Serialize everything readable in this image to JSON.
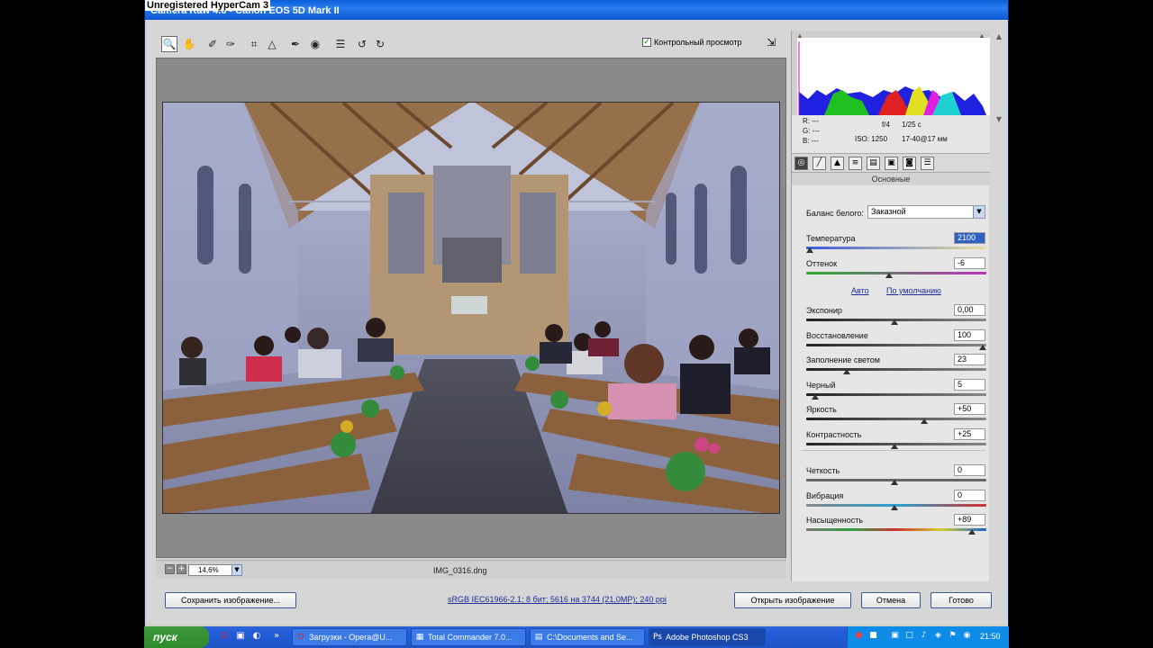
{
  "watermark": "Unregistered HyperCam 3",
  "window": {
    "title": "Camera Raw 4.6  -  Canon EOS 5D Mark II"
  },
  "toolbar": {
    "tools": [
      "zoom-icon",
      "hand-icon",
      "white-balance-icon",
      "color-sampler-icon",
      "crop-icon",
      "straighten-icon",
      "retouch-icon",
      "red-eye-icon",
      "preferences-icon",
      "rotate-left-icon",
      "rotate-right-icon"
    ],
    "preview_label": "Контрольный просмотр",
    "preview_checked": true
  },
  "status": {
    "zoom": "14,6%",
    "filename": "IMG_0316.dng"
  },
  "buttons": {
    "save": "Сохранить изображение...",
    "workflow": "sRGB IEC61966-2.1; 8 бит; 5616 на 3744 (21,0МР); 240 ppi",
    "open": "Открыть изображение",
    "cancel": "Отмена",
    "done": "Готово"
  },
  "info": {
    "r": "R:  ---",
    "g": "G:  ---",
    "b": "B:  ---",
    "aperture": "f/4",
    "shutter": "1/25 с",
    "iso": "ISO: 1250",
    "lens": "17-40@17 мм"
  },
  "panel": {
    "section": "Основные",
    "wb_label": "Баланс белого:",
    "wb_value": "Заказной",
    "auto": "Авто",
    "default": "По умолчанию",
    "sliders": [
      {
        "label": "Температура",
        "value": "2100",
        "pos": 0.02
      },
      {
        "label": "Оттенок",
        "value": "-6",
        "pos": 0.47
      },
      {
        "label": "Экспонир",
        "value": "0,00",
        "pos": 0.5
      },
      {
        "label": "Восстановление",
        "value": "100",
        "pos": 1.0
      },
      {
        "label": "Заполнение светом",
        "value": "23",
        "pos": 0.23
      },
      {
        "label": "Черный",
        "value": "5",
        "pos": 0.05
      },
      {
        "label": "Яркость",
        "value": "+50",
        "pos": 0.67
      },
      {
        "label": "Контрастность",
        "value": "+25",
        "pos": 0.5
      },
      {
        "label": "Четкость",
        "value": "0",
        "pos": 0.5
      },
      {
        "label": "Вибрация",
        "value": "0",
        "pos": 0.5
      },
      {
        "label": "Насыщенность",
        "value": "+89",
        "pos": 0.94
      }
    ]
  },
  "taskbar": {
    "start": "пуск",
    "tasks": [
      {
        "icon": "opera-icon",
        "label": "Загрузки - Opera@U..."
      },
      {
        "icon": "total-commander-icon",
        "label": "Total Commander 7.0..."
      },
      {
        "icon": "folder-icon",
        "label": "C:\\Documents and Se..."
      },
      {
        "icon": "photoshop-icon",
        "label": "Adobe Photoshop CS3"
      }
    ],
    "clock": "21:50"
  }
}
